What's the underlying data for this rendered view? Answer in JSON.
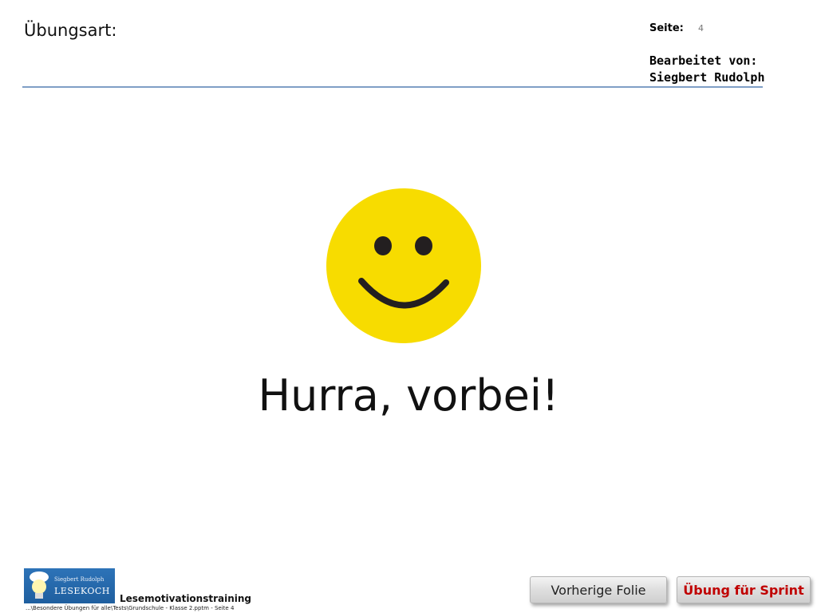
{
  "header": {
    "title": "Übungsart:",
    "page_label": "Seite:",
    "page_number": "4",
    "author_label": "Bearbeitet von:",
    "author_name": "Siegbert Rudolph"
  },
  "main": {
    "icon": "smiley-face-icon",
    "message": "Hurra, vorbei!"
  },
  "footer": {
    "logo": {
      "small_text": "Siegbert Rudolph",
      "brand_text": "LESEKOCH",
      "icon": "chef-lightbulb-icon"
    },
    "title": "Lesemotivationstraining",
    "path": "...\\Besondere Übungen für alle\\Tests\\Grundschule - Klasse 2.pptm - Seite 4"
  },
  "buttons": {
    "previous_label": "Vorherige Folie",
    "sprint_label": "Übung für Sprint"
  },
  "colors": {
    "rule": "#7f9fc6",
    "smiley_yellow": "#f7dc00",
    "sprint_text": "#c00000",
    "logo_blue": "#2d73b8"
  }
}
